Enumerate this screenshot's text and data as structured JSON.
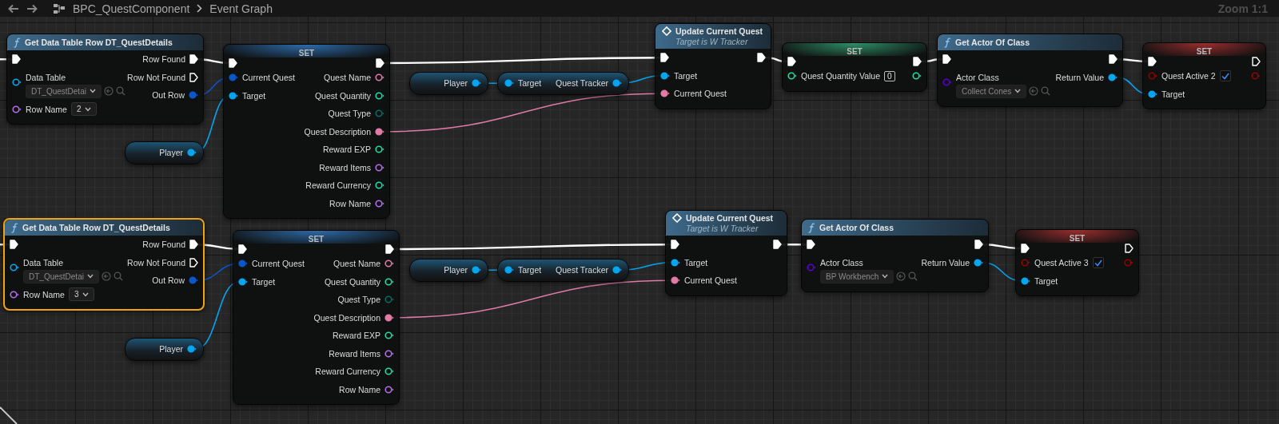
{
  "toolbar": {
    "breadcrumb": [
      "BPC_QuestComponent",
      "Event Graph"
    ],
    "zoom_label": "Zoom 1:1"
  },
  "nodes": [
    {
      "kind": "function",
      "title": "Get Data Table Row DT_QuestDetails",
      "selected": false,
      "inputs": [
        {
          "kind": "exec",
          "connected": true
        },
        {
          "kind": "object",
          "label": "Data Table",
          "connected": false,
          "widget": {
            "kind": "asset",
            "value": "DT_QuestDetai"
          }
        },
        {
          "kind": "name",
          "label": "Row Name",
          "connected": false,
          "widget": {
            "kind": "dropdown",
            "value": "2"
          }
        }
      ],
      "outputs": [
        {
          "kind": "exec",
          "label": "Row Found",
          "connected": true
        },
        {
          "kind": "exec",
          "label": "Row Not Found",
          "connected": false
        },
        {
          "kind": "struct",
          "label": "Out Row",
          "connected": true
        }
      ]
    },
    {
      "kind": "set",
      "title": "SET",
      "selected": false,
      "inputs": [
        {
          "kind": "exec",
          "connected": true
        },
        {
          "kind": "struct",
          "label": "Current Quest",
          "connected": true
        },
        {
          "kind": "object",
          "label": "Target",
          "connected": true
        }
      ],
      "outputs": [
        {
          "kind": "exec",
          "connected": true
        },
        {
          "kind": "text",
          "label": "Quest Name",
          "connected": false
        },
        {
          "kind": "integer",
          "label": "Quest Quantity",
          "connected": false
        },
        {
          "kind": "byte",
          "label": "Quest Type",
          "connected": false
        },
        {
          "kind": "text",
          "label": "Quest Description",
          "connected": true
        },
        {
          "kind": "integer",
          "label": "Reward EXP",
          "connected": false
        },
        {
          "kind": "name",
          "label": "Reward Items",
          "connected": false
        },
        {
          "kind": "integer",
          "label": "Reward Currency",
          "connected": false
        },
        {
          "kind": "name",
          "label": "Row Name",
          "connected": false
        }
      ]
    },
    {
      "kind": "getter",
      "selected": false,
      "outputs": [
        {
          "kind": "object",
          "label": "Player",
          "connected": true
        }
      ]
    },
    {
      "kind": "getter",
      "selected": false,
      "outputs": [
        {
          "kind": "object",
          "label": "Player",
          "connected": true
        }
      ]
    },
    {
      "kind": "getter",
      "selected": false,
      "inputs": [
        {
          "kind": "object",
          "label": "Target",
          "connected": true
        }
      ],
      "outputs": [
        {
          "kind": "object",
          "label": "Quest Tracker",
          "connected": true
        }
      ]
    },
    {
      "kind": "message",
      "title": "Update Current Quest",
      "subtitle": "Target is W Tracker",
      "selected": false,
      "inputs": [
        {
          "kind": "exec",
          "connected": true
        },
        {
          "kind": "object",
          "label": "Target",
          "connected": true
        },
        {
          "kind": "text",
          "label": "Current Quest",
          "connected": true
        }
      ],
      "outputs": [
        {
          "kind": "exec",
          "connected": true
        }
      ]
    },
    {
      "kind": "set",
      "title": "SET",
      "selected": false,
      "inputs": [
        {
          "kind": "exec",
          "connected": true
        },
        {
          "kind": "integer",
          "label": "Quest Quantity Value",
          "connected": false,
          "widget": {
            "kind": "number",
            "value": "0"
          }
        }
      ],
      "outputs": [
        {
          "kind": "exec",
          "connected": true
        },
        {
          "kind": "integer",
          "connected": false
        }
      ]
    },
    {
      "kind": "function",
      "title": "Get Actor Of Class",
      "selected": false,
      "inputs": [
        {
          "kind": "exec",
          "connected": true
        },
        {
          "kind": "class",
          "label": "Actor Class",
          "connected": false,
          "widget": {
            "kind": "asset",
            "value": "Collect Cones"
          }
        }
      ],
      "outputs": [
        {
          "kind": "exec",
          "connected": true
        },
        {
          "kind": "object",
          "label": "Return Value",
          "connected": true
        }
      ]
    },
    {
      "kind": "set",
      "title": "SET",
      "selected": false,
      "inputs": [
        {
          "kind": "exec",
          "connected": true
        },
        {
          "kind": "boolean",
          "label": "Quest Active 2",
          "connected": false,
          "widget": {
            "kind": "checkbox",
            "checked": true
          }
        },
        {
          "kind": "object",
          "label": "Target",
          "connected": true
        }
      ],
      "outputs": [
        {
          "kind": "exec",
          "connected": false
        },
        {
          "kind": "boolean",
          "connected": false
        }
      ]
    },
    {
      "kind": "function",
      "title": "Get Data Table Row DT_QuestDetails",
      "selected": true,
      "inputs": [
        {
          "kind": "exec",
          "connected": true
        },
        {
          "kind": "object",
          "label": "Data Table",
          "connected": false,
          "widget": {
            "kind": "asset",
            "value": "DT_QuestDetai"
          }
        },
        {
          "kind": "name",
          "label": "Row Name",
          "connected": false,
          "widget": {
            "kind": "dropdown",
            "value": "3"
          }
        }
      ],
      "outputs": [
        {
          "kind": "exec",
          "label": "Row Found",
          "connected": true
        },
        {
          "kind": "exec",
          "label": "Row Not Found",
          "connected": false
        },
        {
          "kind": "struct",
          "label": "Out Row",
          "connected": true
        }
      ]
    },
    {
      "kind": "set",
      "title": "SET",
      "selected": false,
      "inputs": [
        {
          "kind": "exec",
          "connected": true
        },
        {
          "kind": "struct",
          "label": "Current Quest",
          "connected": true
        },
        {
          "kind": "object",
          "label": "Target",
          "connected": true
        }
      ],
      "outputs": [
        {
          "kind": "exec",
          "connected": true
        },
        {
          "kind": "text",
          "label": "Quest Name",
          "connected": false
        },
        {
          "kind": "integer",
          "label": "Quest Quantity",
          "connected": false
        },
        {
          "kind": "byte",
          "label": "Quest Type",
          "connected": false
        },
        {
          "kind": "text",
          "label": "Quest Description",
          "connected": true
        },
        {
          "kind": "integer",
          "label": "Reward EXP",
          "connected": false
        },
        {
          "kind": "name",
          "label": "Reward Items",
          "connected": false
        },
        {
          "kind": "integer",
          "label": "Reward Currency",
          "connected": false
        },
        {
          "kind": "name",
          "label": "Row Name",
          "connected": false
        }
      ]
    },
    {
      "kind": "getter",
      "selected": false,
      "outputs": [
        {
          "kind": "object",
          "label": "Player",
          "connected": true
        }
      ]
    },
    {
      "kind": "getter",
      "selected": false,
      "outputs": [
        {
          "kind": "object",
          "label": "Player",
          "connected": true
        }
      ]
    },
    {
      "kind": "getter",
      "selected": false,
      "inputs": [
        {
          "kind": "object",
          "label": "Target",
          "connected": true
        }
      ],
      "outputs": [
        {
          "kind": "object",
          "label": "Quest Tracker",
          "connected": true
        }
      ]
    },
    {
      "kind": "message",
      "title": "Update Current Quest",
      "subtitle": "Target is W Tracker",
      "selected": false,
      "inputs": [
        {
          "kind": "exec",
          "connected": true
        },
        {
          "kind": "object",
          "label": "Target",
          "connected": true
        },
        {
          "kind": "text",
          "label": "Current Quest",
          "connected": true
        }
      ],
      "outputs": [
        {
          "kind": "exec",
          "connected": true
        }
      ]
    },
    {
      "kind": "function",
      "title": "Get Actor Of Class",
      "selected": false,
      "inputs": [
        {
          "kind": "exec",
          "connected": true
        },
        {
          "kind": "class",
          "label": "Actor Class",
          "connected": false,
          "widget": {
            "kind": "asset",
            "value": "BP Workbench"
          }
        }
      ],
      "outputs": [
        {
          "kind": "exec",
          "connected": true
        },
        {
          "kind": "object",
          "label": "Return Value",
          "connected": true
        }
      ]
    },
    {
      "kind": "set",
      "title": "SET",
      "selected": false,
      "inputs": [
        {
          "kind": "exec",
          "connected": true
        },
        {
          "kind": "boolean",
          "label": "Quest Active 3",
          "connected": false,
          "widget": {
            "kind": "checkbox",
            "checked": true
          }
        },
        {
          "kind": "object",
          "label": "Target",
          "connected": true
        }
      ],
      "outputs": [
        {
          "kind": "exec",
          "connected": false
        },
        {
          "kind": "boolean",
          "connected": false
        }
      ]
    }
  ]
}
